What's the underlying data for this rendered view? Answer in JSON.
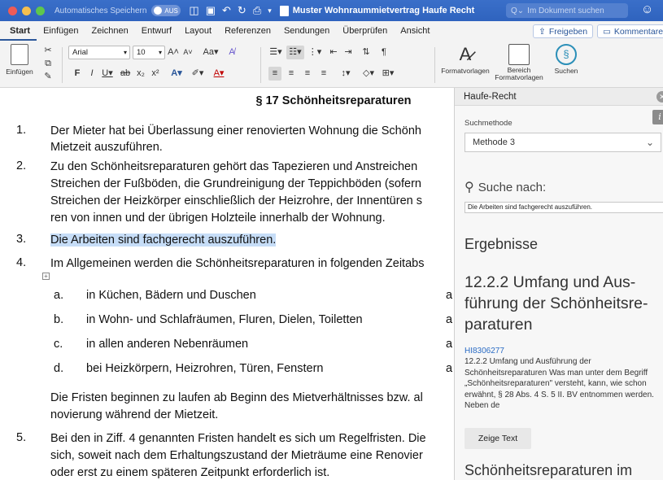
{
  "titlebar": {
    "autosave_label": "Automatisches Speichern",
    "autosave_state": "AUS",
    "document_title": "Muster Wohnraummietvertrag Haufe Recht",
    "search_placeholder": "Im Dokument suchen",
    "traffic_colors": [
      "#ee5b57",
      "#f5bf4f",
      "#5ec64d"
    ]
  },
  "ribbon": {
    "tabs": [
      "Start",
      "Einfügen",
      "Zeichnen",
      "Entwurf",
      "Layout",
      "Referenzen",
      "Sendungen",
      "Überprüfen",
      "Ansicht"
    ],
    "share_label": "Freigeben",
    "comments_label": "Kommentare",
    "paste_label": "Einfügen",
    "font_name": "Arial",
    "font_size": "10",
    "styles_label": "Formatvorlagen",
    "styles_pane_label": "Bereich\nFormatvorlagen",
    "search_label": "Suchen"
  },
  "document": {
    "heading": "§ 17 Schönheitsreparaturen",
    "items": [
      {
        "num": "1.",
        "lines": [
          "Der Mieter hat bei Überlassung einer renovierten Wohnung die Schönh",
          "Mietzeit auszuführen."
        ]
      },
      {
        "num": "2.",
        "lines": [
          "Zu den Schönheitsreparaturen gehört das Tapezieren und Anstreichen",
          "Streichen der Fußböden, die Grundreinigung der Teppichböden (sofern",
          "Streichen der Heizkörper einschließlich der Heizrohre, der Innentüren s",
          "ren von innen und der übrigen Holzteile innerhalb der Wohnung."
        ]
      },
      {
        "num": "3.",
        "lines": [
          "Die Arbeiten sind fachgerecht auszuführen."
        ]
      },
      {
        "num": "4.",
        "lines": [
          "Im Allgemeinen werden die Schönheitsreparaturen in folgenden Zeitabs"
        ]
      }
    ],
    "subitems": [
      {
        "letter": "a.",
        "text": "in Küchen, Bädern und Duschen",
        "tail": "a"
      },
      {
        "letter": "b.",
        "text": "in Wohn- und Schlafräumen, Fluren, Dielen, Toiletten",
        "tail": "a"
      },
      {
        "letter": "c.",
        "text": "in allen anderen Nebenräumen",
        "tail": "a"
      },
      {
        "letter": "d.",
        "text": "bei Heizkörpern, Heizrohren, Türen, Fenstern",
        "tail": "a"
      }
    ],
    "fristen_lines": [
      "Die Fristen beginnen zu laufen ab Beginn des Mietverhältnisses bzw. al",
      "novierung während der Mietzeit."
    ],
    "item5": {
      "num": "5.",
      "lines": [
        "Bei den in Ziff. 4 genannten Fristen handelt es sich um Regelfristen. Die",
        "sich, soweit nach dem Erhaltungszustand der Mieträume eine Renovier",
        "oder erst zu einem späteren Zeitpunkt erforderlich ist."
      ]
    }
  },
  "pane": {
    "title": "Haufe-Recht",
    "search_method_label": "Suchmethode",
    "search_method_value": "Methode 3",
    "search_for_label": "Suche nach:",
    "search_query": "Die Arbeiten sind fachgerecht auszuführen.",
    "results_heading": "Ergebnisse",
    "result_title": "12.2.2   Umfang und Aus-\nführung der Schönheitsre-\nparaturen",
    "result_id": "HI8306277",
    "result_snippet": "12.2.2   Umfang und Ausführung der Schönheitsreparaturen Was man unter dem Begriff „Schönheitsreparaturen\" versteht, kann, wie schon erwähnt, § 28 Abs. 4 S. 5 II. BV entnommen werden. Neben de",
    "show_text_button": "Zeige Text",
    "next_result_title": "Schönheitsreparaturen im"
  }
}
